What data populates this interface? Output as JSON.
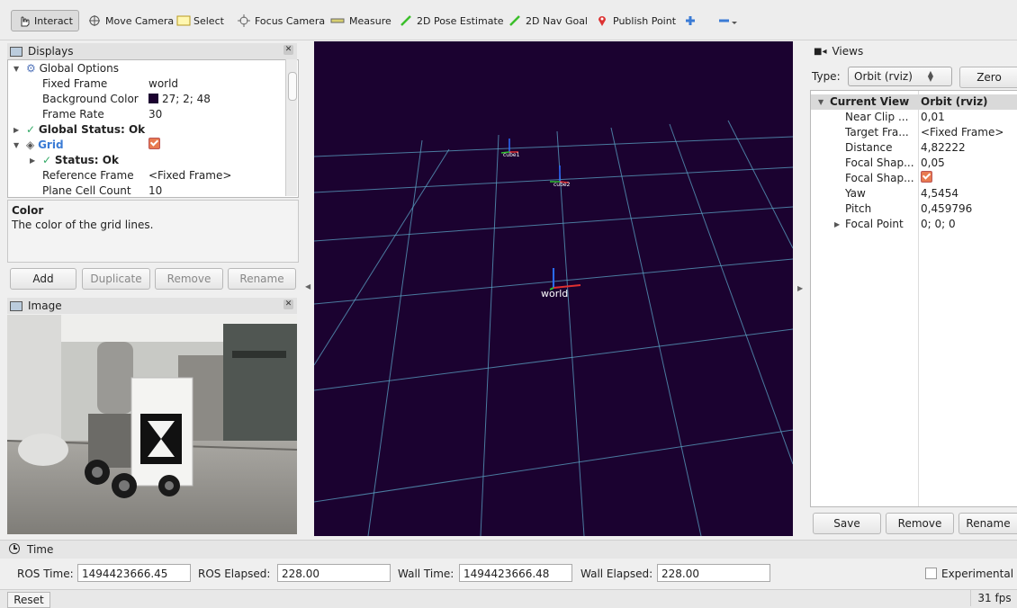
{
  "toolbar": {
    "interact": "Interact",
    "move_camera": "Move Camera",
    "select": "Select",
    "focus_camera": "Focus Camera",
    "measure": "Measure",
    "pose_estimate": "2D Pose Estimate",
    "nav_goal": "2D Nav Goal",
    "publish_point": "Publish Point"
  },
  "displays": {
    "title": "Displays",
    "rows": [
      {
        "key": "Global Options",
        "value": ""
      },
      {
        "key": "Fixed Frame",
        "value": "world"
      },
      {
        "key": "Background Color",
        "value": "27; 2; 48"
      },
      {
        "key": "Frame Rate",
        "value": "30"
      },
      {
        "key": "Global Status: Ok",
        "value": ""
      },
      {
        "key": "Grid",
        "value": ""
      },
      {
        "key": "Status: Ok",
        "value": ""
      },
      {
        "key": "Reference Frame",
        "value": "<Fixed Frame>"
      },
      {
        "key": "Plane Cell Count",
        "value": "10"
      }
    ],
    "desc_title": "Color",
    "desc_text": "The color of the grid lines.",
    "buttons": {
      "add": "Add",
      "duplicate": "Duplicate",
      "remove": "Remove",
      "rename": "Rename"
    }
  },
  "image_panel": {
    "title": "Image"
  },
  "scene": {
    "background": "#1b0230",
    "grid_color": "#5aa3c4",
    "frames": [
      "world",
      "cube1",
      "cube2"
    ]
  },
  "views": {
    "title": "Views",
    "type_label": "Type:",
    "type_value": "Orbit (rviz)",
    "zero": "Zero",
    "rows": [
      {
        "key": "Current View",
        "value": "Orbit (rviz)"
      },
      {
        "key": "Near Clip ...",
        "value": "0,01"
      },
      {
        "key": "Target Fra...",
        "value": "<Fixed Frame>"
      },
      {
        "key": "Distance",
        "value": "4,82222"
      },
      {
        "key": "Focal Shap...",
        "value": "0,05"
      },
      {
        "key": "Focal Shap...",
        "value": ""
      },
      {
        "key": "Yaw",
        "value": "4,5454"
      },
      {
        "key": "Pitch",
        "value": "0,459796"
      },
      {
        "key": "Focal Point",
        "value": "0; 0; 0"
      }
    ],
    "buttons": {
      "save": "Save",
      "remove": "Remove",
      "rename": "Rename"
    }
  },
  "time": {
    "title": "Time",
    "ros_time_label": "ROS Time:",
    "ros_time": "1494423666.45",
    "ros_elapsed_label": "ROS Elapsed:",
    "ros_elapsed": "228.00",
    "wall_time_label": "Wall Time:",
    "wall_time": "1494423666.48",
    "wall_elapsed_label": "Wall Elapsed:",
    "wall_elapsed": "228.00",
    "experimental": "Experimental"
  },
  "status": {
    "reset": "Reset",
    "fps": "31 fps"
  }
}
